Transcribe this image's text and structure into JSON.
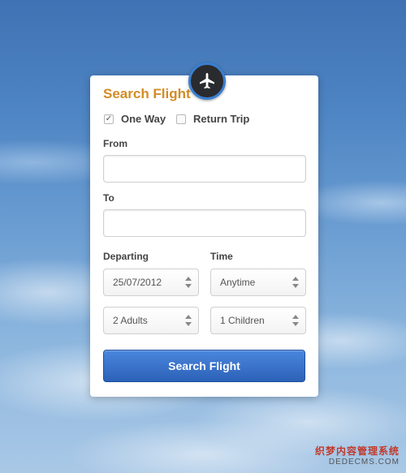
{
  "form": {
    "title": "Search Flight",
    "trip_options": [
      {
        "label": "One Way",
        "checked": true
      },
      {
        "label": "Return Trip",
        "checked": false
      }
    ],
    "from": {
      "label": "From",
      "value": ""
    },
    "to": {
      "label": "To",
      "value": ""
    },
    "departing": {
      "label": "Departing",
      "value": "25/07/2012"
    },
    "time": {
      "label": "Time",
      "value": "Anytime"
    },
    "adults": {
      "value": "2 Adults"
    },
    "children": {
      "value": "1 Children"
    },
    "submit_label": "Search Flight",
    "check_mark": "✓"
  },
  "icons": {
    "badge": "airplane-icon"
  },
  "colors": {
    "title": "#d28c26",
    "button": "#2f66bc",
    "badge_ring": "#3b7fd0"
  },
  "watermark": {
    "cn": "织梦内容管理系统",
    "en": "DEDECMS.COM"
  }
}
